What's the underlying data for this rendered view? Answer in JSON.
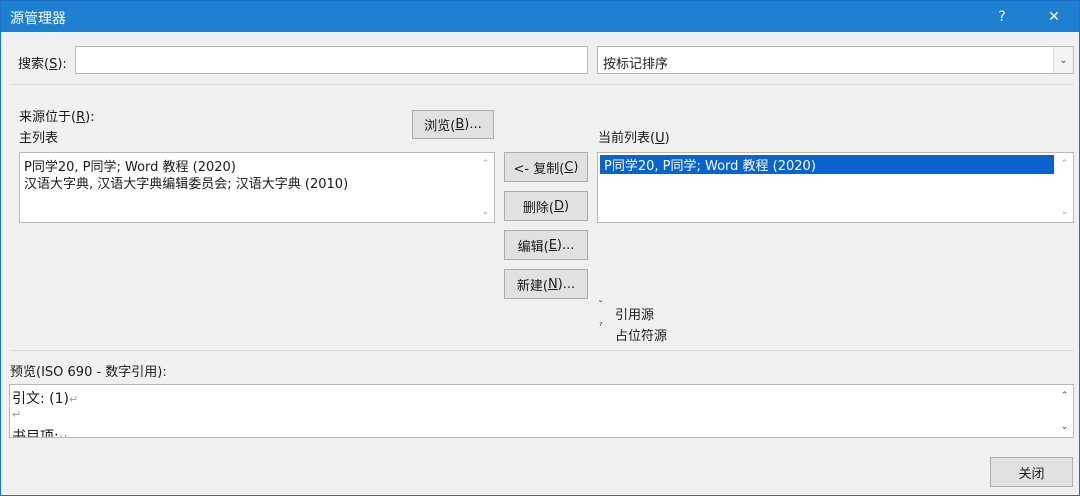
{
  "window": {
    "title": "源管理器",
    "help_label": "?",
    "close_label": "✕"
  },
  "search": {
    "label_pre": "搜索(",
    "label_key": "S",
    "label_post": "):",
    "value": ""
  },
  "sort": {
    "selected": "按标记排序"
  },
  "sources": {
    "location_pre": "来源位于(",
    "location_key": "R",
    "location_post": "):",
    "master_label": "主列表",
    "browse_pre": "浏览(",
    "browse_key": "B",
    "browse_post": ")...",
    "master_items": [
      "P同学20, P同学; Word 教程 (2020)",
      "汉语大字典, 汉语大字典编辑委员会; 汉语大字典 (2010)"
    ],
    "current_label_pre": "当前列表(",
    "current_label_key": "U",
    "current_label_post": ")",
    "current_items": [
      "P同学20, P同学; Word 教程 (2020)"
    ]
  },
  "actions": {
    "copy_pre": "<- 复制(",
    "copy_key": "C",
    "copy_post": ")",
    "delete_pre": "删除(",
    "delete_key": "D",
    "delete_post": ")",
    "edit_pre": "编辑(",
    "edit_key": "E",
    "edit_post": ")...",
    "new_pre": "新建(",
    "new_key": "N",
    "new_post": ")..."
  },
  "legend": {
    "cited": "引用源",
    "placeholder": "占位符源",
    "cited_mark": "ˇ",
    "placeholder_mark": "ˀ"
  },
  "preview": {
    "label": "预览(ISO 690 - 数字引用):",
    "line1": "引文:  (1)",
    "line2": "",
    "line3": "书目项:",
    "para_mark": "↵"
  },
  "footer": {
    "close": "关闭"
  }
}
